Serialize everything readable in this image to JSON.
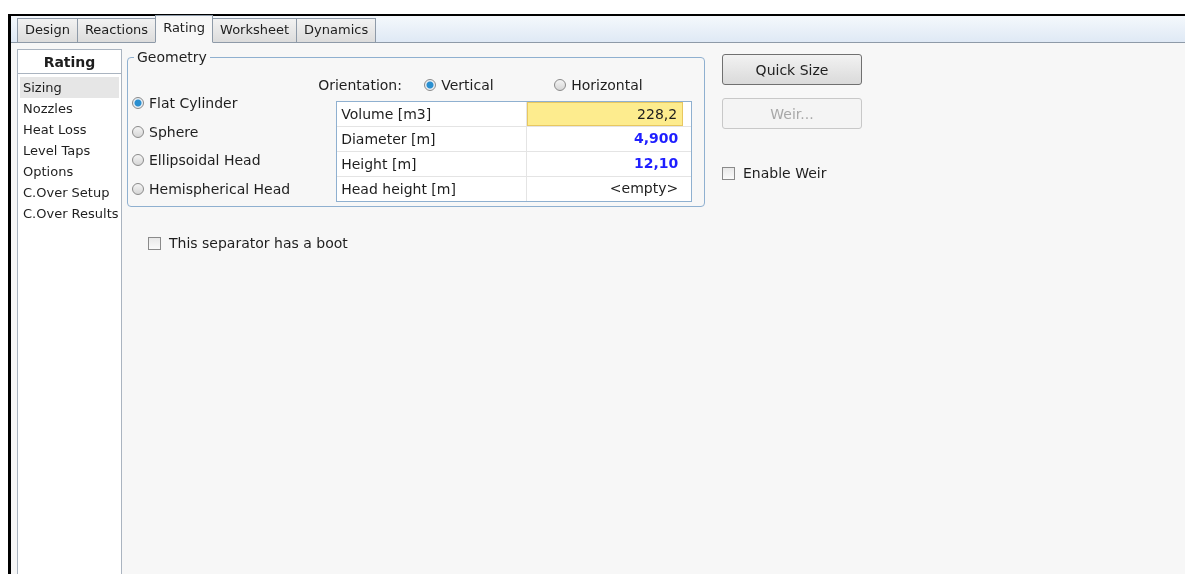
{
  "tabs": [
    {
      "label": "Design",
      "selected": false
    },
    {
      "label": "Reactions",
      "selected": false
    },
    {
      "label": "Rating",
      "selected": true
    },
    {
      "label": "Worksheet",
      "selected": false
    },
    {
      "label": "Dynamics",
      "selected": false
    }
  ],
  "sidebar": {
    "title": "Rating",
    "items": [
      {
        "label": "Sizing",
        "selected": true
      },
      {
        "label": "Nozzles",
        "selected": false
      },
      {
        "label": "Heat Loss",
        "selected": false
      },
      {
        "label": "Level Taps",
        "selected": false
      },
      {
        "label": "Options",
        "selected": false
      },
      {
        "label": "C.Over Setup",
        "selected": false
      },
      {
        "label": "C.Over Results",
        "selected": false
      }
    ]
  },
  "geometry": {
    "title": "Geometry",
    "shapes": [
      {
        "label": "Flat Cylinder",
        "selected": true
      },
      {
        "label": "Sphere",
        "selected": false
      },
      {
        "label": "Ellipsoidal Head",
        "selected": false
      },
      {
        "label": "Hemispherical Head",
        "selected": false
      }
    ],
    "orientation_label": "Orientation:",
    "orientations": [
      {
        "label": "Vertical",
        "selected": true
      },
      {
        "label": "Horizontal",
        "selected": false
      }
    ],
    "rows": [
      {
        "label": "Volume [m3]",
        "value": "228,2",
        "kind": "input"
      },
      {
        "label": "Diameter [m]",
        "value": "4,900",
        "kind": "calculated"
      },
      {
        "label": "Height [m]",
        "value": "12,10",
        "kind": "calculated"
      },
      {
        "label": "Head height [m]",
        "value": "<empty>",
        "kind": "empty"
      }
    ]
  },
  "buttons": [
    {
      "label": "Quick Size",
      "disabled": false
    },
    {
      "label": "Weir...",
      "disabled": true
    }
  ],
  "enable_weir": {
    "label": "Enable Weir",
    "checked": false
  },
  "boot": {
    "label": "This separator has a boot",
    "checked": false
  }
}
